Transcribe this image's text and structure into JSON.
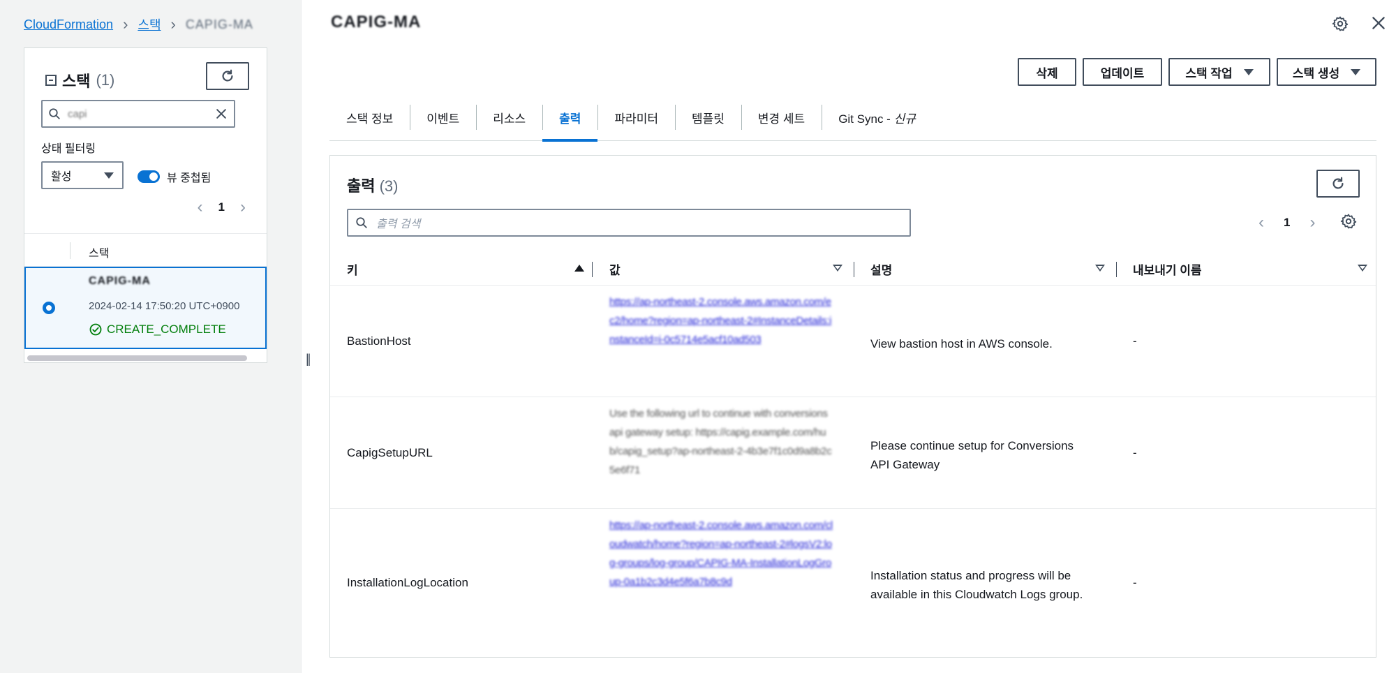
{
  "breadcrumb": {
    "root": "CloudFormation",
    "stacks": "스택",
    "current": "CAPIG-MA"
  },
  "stack_panel": {
    "title": "스택",
    "count": "(1)",
    "search_value": "capi",
    "filter_label": "상태 필터링",
    "filter_value": "활성",
    "toggle_label": "뷰 중첩됨",
    "page": "1",
    "column": "스택",
    "row": {
      "name": "CAPIG-MA",
      "date": "2024-02-14 17:50:20 UTC+0900",
      "status": "CREATE_COMPLETE"
    }
  },
  "main": {
    "title": "CAPIG-MA",
    "buttons": {
      "delete": "삭제",
      "update": "업데이트",
      "stack_actions": "스택 작업",
      "create_stack": "스택 생성"
    },
    "tabs": [
      "스택 정보",
      "이벤트",
      "리소스",
      "출력",
      "파라미터",
      "템플릿",
      "변경 세트"
    ],
    "tab_git": "Git Sync - ",
    "tab_git_new": "신규",
    "outputs": {
      "title": "출력",
      "count": "(3)",
      "search_placeholder": "출력 검색",
      "page": "1",
      "headers": {
        "key": "키",
        "value": "값",
        "description": "설명",
        "export": "내보내기 이름"
      },
      "rows": [
        {
          "key": "BastionHost",
          "value": "https://ap-northeast-2.console.aws.amazon.com/ec2/home?region=ap-northeast-2#InstanceDetails:instanceId=i-0c5714e5acf10ad503",
          "description": "View bastion host in AWS console.",
          "export": "-"
        },
        {
          "key": "CapigSetupURL",
          "value": "Use the following url to continue with conversions api gateway setup: https://capig.example.com/hub/capig_setup?ap-northeast-2-4b3e7f1c0d9a8b2c5e6f71",
          "description": "Please continue setup for Conversions API Gateway",
          "export": "-"
        },
        {
          "key": "InstallationLogLocation",
          "value": "https://ap-northeast-2.console.aws.amazon.com/cloudwatch/home?region=ap-northeast-2#logsV2:log-groups/log-group/CAPIG-MA-InstallationLogGroup-0a1b2c3d4e5f6a7b8c9d",
          "description": "Installation status and progress will be available in this Cloudwatch Logs group.",
          "export": "-"
        }
      ]
    }
  },
  "colors": {
    "link": "#0972d3",
    "success": "#037f0c",
    "text": "#16191f",
    "border": "#414d5c"
  }
}
